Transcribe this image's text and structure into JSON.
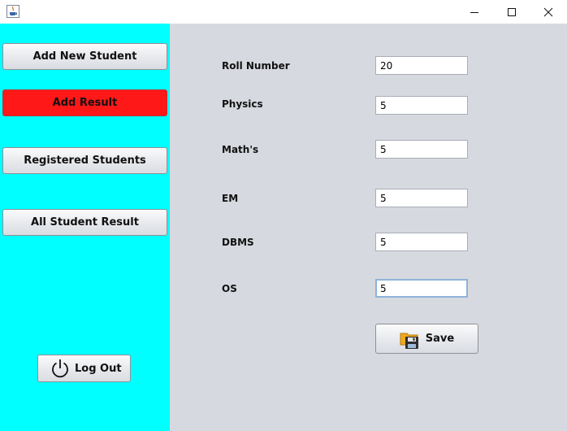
{
  "window": {
    "minimize_icon": "minimize-icon",
    "maximize_icon": "maximize-icon",
    "close_icon": "close-icon"
  },
  "sidebar": {
    "buttons": [
      {
        "label": "Add New Student"
      },
      {
        "label": "Add Result",
        "active": true
      },
      {
        "label": "Registered Students"
      },
      {
        "label": "All Student Result"
      }
    ],
    "logout_label": "Log Out",
    "active_color": "#ff1818",
    "background_color": "#00ffff"
  },
  "form": {
    "fields": [
      {
        "label": "Roll Number",
        "value": "20"
      },
      {
        "label": "Physics",
        "value": "5"
      },
      {
        "label": "Math's",
        "value": "5"
      },
      {
        "label": "EM",
        "value": "5"
      },
      {
        "label": "DBMS",
        "value": "5"
      },
      {
        "label": "OS",
        "value": "5"
      }
    ],
    "save_label": "Save"
  }
}
